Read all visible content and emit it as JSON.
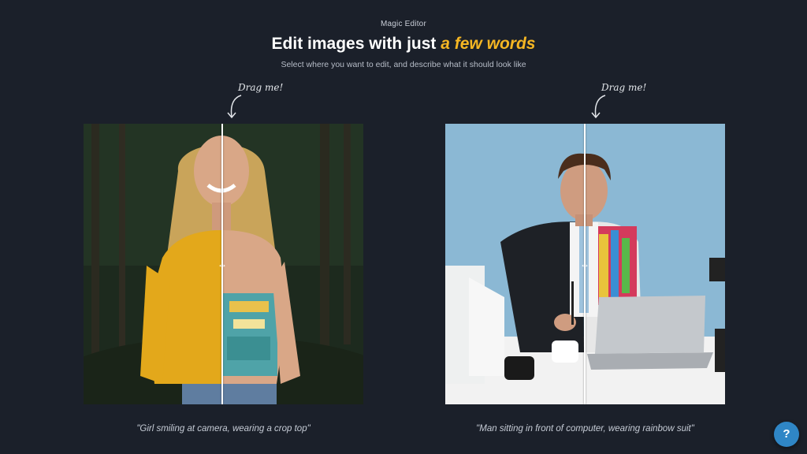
{
  "header": {
    "eyebrow": "Magic Editor",
    "headline_start": "Edit images with just ",
    "headline_accent": "a few words",
    "subhead": "Select where you want to edit, and describe what it should look like"
  },
  "colors": {
    "background": "#1b202a",
    "accent": "#f5b623",
    "help_button": "#2f86c6"
  },
  "examples": [
    {
      "hint": "Drag me!",
      "caption": "\"Girl smiling at camera, wearing a crop top\"",
      "handle_icon": "resize-horizontal-icon"
    },
    {
      "hint": "Drag me!",
      "caption": "\"Man sitting in front of computer, wearing rainbow suit\"",
      "handle_icon": "resize-horizontal-icon"
    }
  ],
  "help": {
    "label": "?"
  }
}
